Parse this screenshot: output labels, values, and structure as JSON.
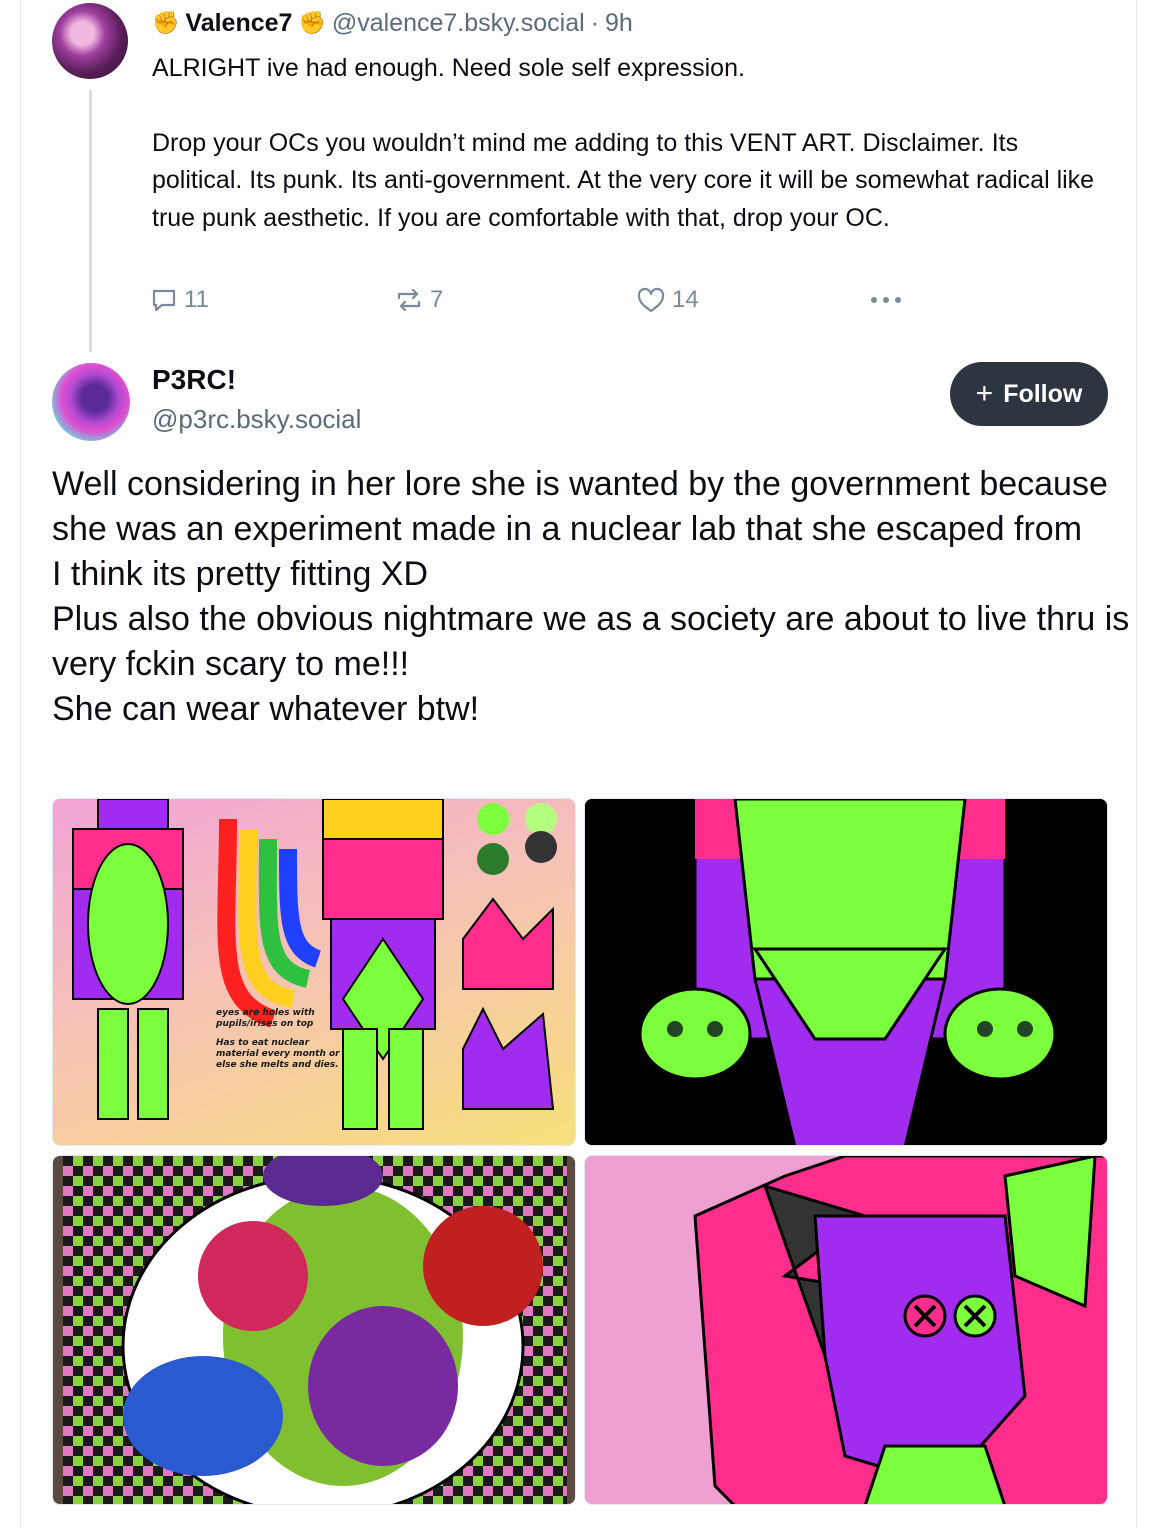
{
  "parent_post": {
    "author_name": "Valence7",
    "name_emoji": "✊",
    "handle": "@valence7.bsky.social",
    "separator": "·",
    "time": "9h",
    "text_line1": "ALRIGHT ive had enough. Need sole self expression.",
    "text_para2": "Drop your OCs you wouldn’t mind me adding to this VENT ART. Disclaimer. Its political. Its punk. Its anti-government. At the very core it will be somewhat radical like true punk aesthetic. If you are comfortable with that, drop your OC.",
    "reply_count": "11",
    "repost_count": "7",
    "like_count": "14",
    "icons": {
      "reply": "reply-icon",
      "repost": "repost-icon",
      "like": "heart-icon",
      "more": "more-icon"
    }
  },
  "reply_post": {
    "author_name": "P3RC!",
    "handle": "@p3rc.bsky.social",
    "follow_label": "Follow",
    "follow_icon": "+",
    "lines": [
      "Well considering in her lore she is wanted by the government because she was an experiment made in a nuclear lab that she escaped from",
      "I think its pretty fitting XD",
      "Plus also the obvious nightmare we as a society are about to live thru is very fckin scary to me!!!",
      "She can wear whatever btw!"
    ],
    "sheet_notes": [
      "eyes are holes with pupils/irises on top",
      "Has to eat nuclear material every month or else she melts and dies."
    ]
  },
  "colors": {
    "follow_bg": "#2c3540",
    "muted": "#5b6b7c",
    "oc_green": "#7cff3c",
    "oc_purple": "#a12cf0",
    "oc_pink": "#ff2e8c"
  }
}
